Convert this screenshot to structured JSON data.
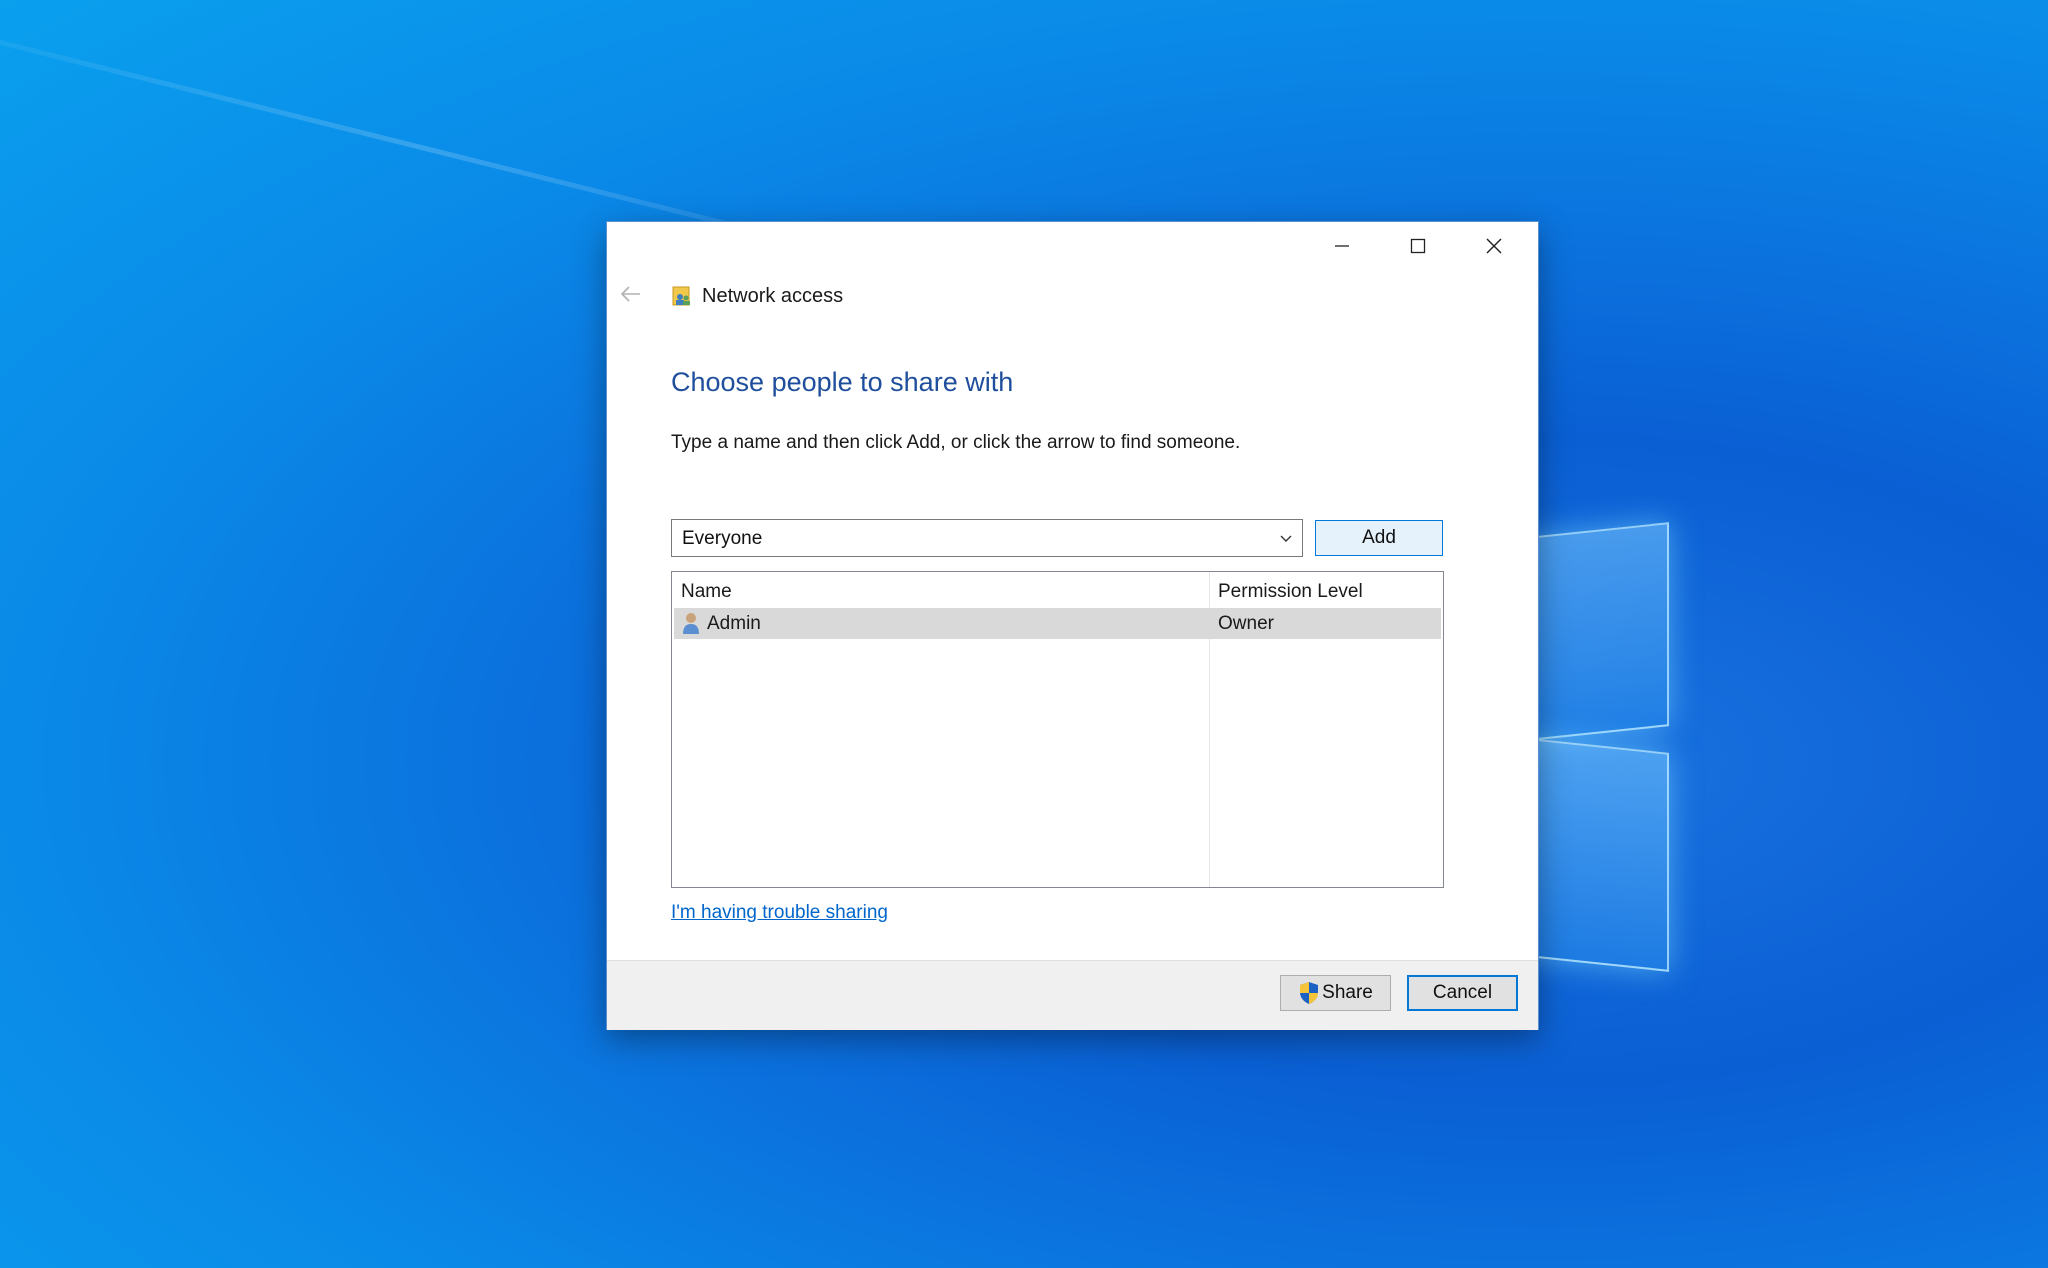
{
  "window": {
    "title": "Network access",
    "icons": {
      "back": "back-arrow-icon",
      "title": "network-sharing-icon",
      "minimize": "minimize-icon",
      "maximize": "maximize-icon",
      "close": "close-icon"
    }
  },
  "main": {
    "heading": "Choose people to share with",
    "instructions": "Type a name and then click Add, or click the arrow to find someone.",
    "name_combo": {
      "value": "Everyone",
      "icon": "chevron-down-icon"
    },
    "add_label": "Add",
    "table": {
      "columns": [
        "Name",
        "Permission Level"
      ],
      "rows": [
        {
          "name": "Admin",
          "permission": "Owner",
          "icon": "user-icon",
          "selected": true
        }
      ]
    },
    "trouble_link": "I'm having trouble sharing"
  },
  "footer": {
    "share_label": "Share",
    "share_icon": "uac-shield-icon",
    "cancel_label": "Cancel"
  },
  "colors": {
    "heading": "#1f4e9c",
    "link": "#0066cc",
    "accent": "#0078d7",
    "selected_row": "#d9d9d9"
  }
}
